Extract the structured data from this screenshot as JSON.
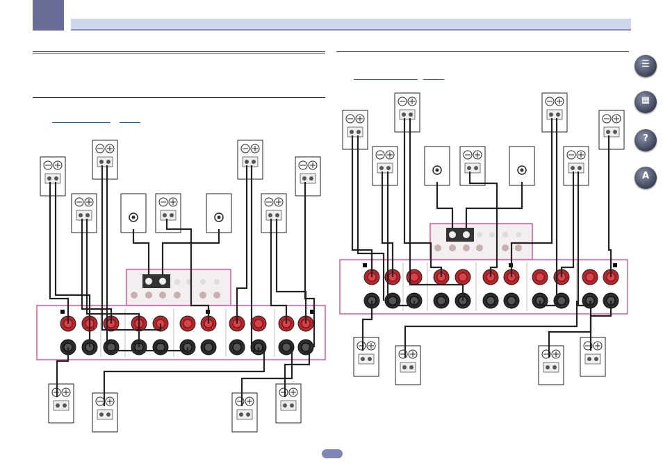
{
  "header": {
    "chapter_marker": "",
    "title": ""
  },
  "left_section": {
    "heading": "",
    "subheading": "",
    "reference_links": [
      "",
      ""
    ]
  },
  "right_section": {
    "heading": "",
    "reference_links": [
      "",
      ""
    ]
  },
  "nav_icons": [
    {
      "icon": "book-icon",
      "label": ""
    },
    {
      "icon": "remote-icon",
      "label": ""
    },
    {
      "icon": "settings-help-icon",
      "label": ""
    },
    {
      "icon": "a-z-index-icon",
      "label": ""
    }
  ],
  "page_number": "",
  "colors": {
    "accent": "#6a6d98",
    "header_band": "#cdd6ea",
    "panel_outline": "#e0559a",
    "terminal_red": "#b3262c",
    "terminal_black": "#2b2b2b",
    "link": "#1a5fb4"
  }
}
